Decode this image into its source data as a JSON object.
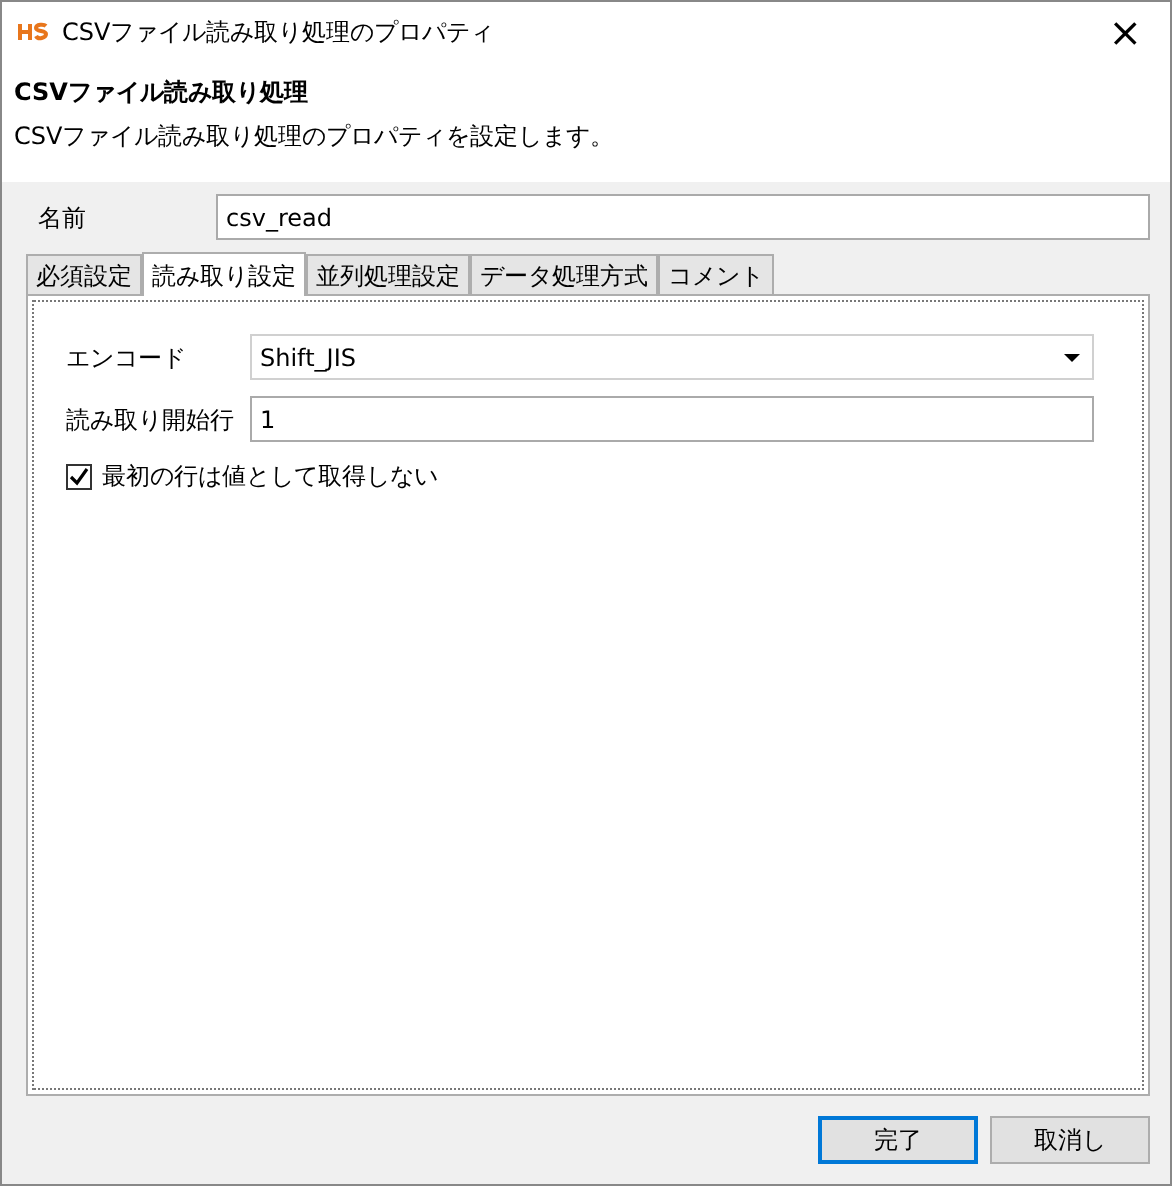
{
  "window": {
    "title": "CSVファイル読み取り処理のプロパティ",
    "close": "×"
  },
  "header": {
    "title": "CSVファイル読み取り処理",
    "description": "CSVファイル読み取り処理のプロパティを設定します。"
  },
  "name_field": {
    "label": "名前",
    "value": "csv_read"
  },
  "tabs": [
    {
      "label": "必須設定",
      "selected": false
    },
    {
      "label": "読み取り設定",
      "selected": true
    },
    {
      "label": "並列処理設定",
      "selected": false
    },
    {
      "label": "データ処理方式",
      "selected": false
    },
    {
      "label": "コメント",
      "selected": false
    }
  ],
  "settings": [
    {
      "kind": "dropdown",
      "label": "エンコード",
      "value": "Shift_JIS"
    },
    {
      "kind": "text",
      "label": "読み取り開始行",
      "value": "1"
    },
    {
      "kind": "checkbox",
      "label": "最初の行は値として取得しない",
      "checked": true
    }
  ],
  "buttons": [
    {
      "label": "完了",
      "default": true
    },
    {
      "label": "取消し",
      "default": false
    }
  ]
}
